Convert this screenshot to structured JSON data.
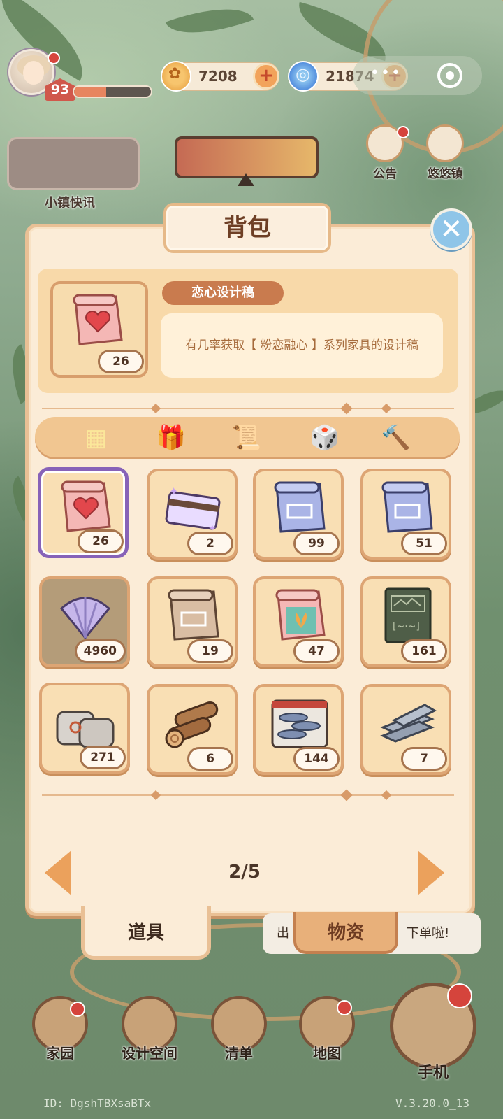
{
  "hud": {
    "level": "93",
    "exp_fraction": 0.42,
    "gold": "7208",
    "gems": "21874",
    "settings_dots": "•••"
  },
  "side": {
    "news_label": "小镇快讯",
    "notice_label": "公告",
    "town_label": "悠悠镇"
  },
  "panel": {
    "title": "背包",
    "close_symbol": "✕",
    "selected_name": "恋心设计稿",
    "selected_desc": "有几率获取【 粉恋融心 】系列家具的设计稿",
    "selected_count": "26",
    "categories": [
      {
        "name": "all",
        "icon": "grid-icon",
        "glyph": "▦"
      },
      {
        "name": "gift",
        "icon": "gift-box-icon",
        "glyph": "🎁"
      },
      {
        "name": "scroll",
        "icon": "scroll-icon",
        "glyph": "📜"
      },
      {
        "name": "dice",
        "icon": "dice-icon",
        "glyph": "🎲"
      },
      {
        "name": "tools",
        "icon": "hammer-icon",
        "glyph": "🔨"
      }
    ],
    "items": [
      {
        "name": "heart-design-scroll",
        "count": "26"
      },
      {
        "name": "sparkle-card",
        "count": "2"
      },
      {
        "name": "blue-blueprint-1",
        "count": "99"
      },
      {
        "name": "blue-blueprint-2",
        "count": "51"
      },
      {
        "name": "seashell",
        "count": "4960"
      },
      {
        "name": "beige-blueprint",
        "count": "19"
      },
      {
        "name": "lotus-design-scroll",
        "count": "47"
      },
      {
        "name": "green-book",
        "count": "161"
      },
      {
        "name": "sacks",
        "count": "271"
      },
      {
        "name": "wood-logs",
        "count": "6"
      },
      {
        "name": "fish-tray",
        "count": "144"
      },
      {
        "name": "steel-beams",
        "count": "7"
      }
    ],
    "page": "2/5",
    "tab_items": "道具",
    "tab_materials": "物资",
    "speech_left": "出",
    "speech_right": "下单啦!"
  },
  "nav": {
    "home": "家园",
    "design": "设计空间",
    "list": "清单",
    "map": "地图",
    "phone": "手机"
  },
  "footer": {
    "id": "ID:  DgshTBXsaBTx",
    "version": "V.3.20.0_13"
  },
  "colors": {
    "panel_bg": "#fbecd7",
    "panel_border": "#e9c095",
    "selected_border": "#8762b8",
    "accent_orange": "#eba15c",
    "close_blue": "#8fc5e8"
  }
}
